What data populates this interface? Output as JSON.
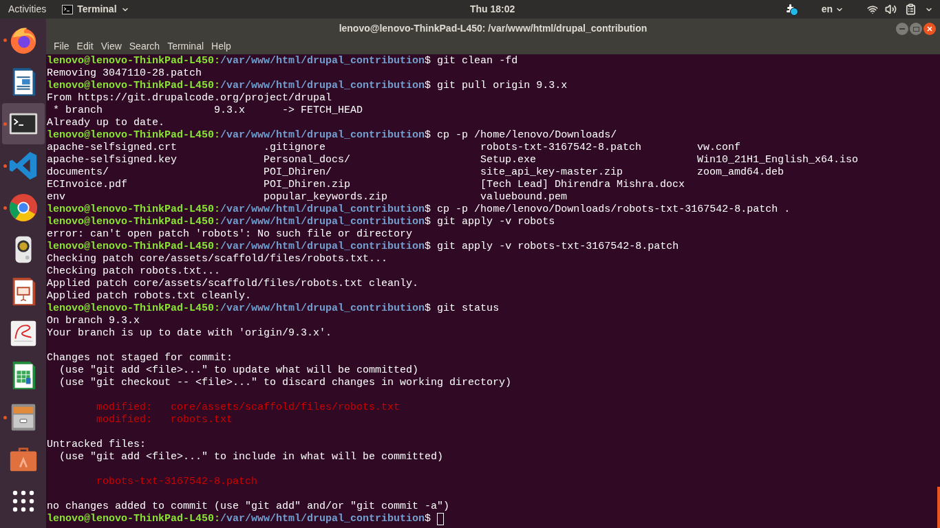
{
  "top_bar": {
    "activities": "Activities",
    "app_menu": "Terminal",
    "clock": "Thu 18:02",
    "language": "en"
  },
  "dock": [
    {
      "kind": "fox",
      "running": true,
      "selected": false
    },
    {
      "kind": "document",
      "running": false,
      "selected": false
    },
    {
      "kind": "terminal",
      "running": true,
      "selected": true
    },
    {
      "kind": "code",
      "running": true,
      "selected": false
    },
    {
      "kind": "globe",
      "running": true,
      "selected": false
    },
    {
      "kind": "speaker",
      "running": false,
      "selected": false
    },
    {
      "kind": "slides",
      "running": false,
      "selected": false
    },
    {
      "kind": "reader",
      "running": false,
      "selected": false
    },
    {
      "kind": "sheet",
      "running": false,
      "selected": false
    },
    {
      "kind": "cabinet",
      "running": true,
      "selected": false
    },
    {
      "kind": "bag",
      "running": false,
      "selected": false
    },
    {
      "kind": "apps",
      "running": false,
      "selected": false
    }
  ],
  "window": {
    "title": "lenovo@lenovo-ThinkPad-L450: /var/www/html/drupal_contribution",
    "menu": [
      "File",
      "Edit",
      "View",
      "Search",
      "Terminal",
      "Help"
    ]
  },
  "terminal": {
    "lines": [
      {
        "kind": "prompt",
        "user": "lenovo@lenovo-ThinkPad-L450:",
        "path": "/var/www/html/drupal_contribution",
        "command": "$ git clean -fd"
      },
      {
        "kind": "output",
        "text": "Removing 3047110-28.patch"
      },
      {
        "kind": "prompt",
        "user": "lenovo@lenovo-ThinkPad-L450:",
        "path": "/var/www/html/drupal_contribution",
        "command": "$ git pull origin 9.3.x"
      },
      {
        "kind": "output",
        "text": "From https://git.drupalcode.org/project/drupal"
      },
      {
        "kind": "output",
        "text": " * branch                  9.3.x      -> FETCH_HEAD"
      },
      {
        "kind": "output",
        "text": "Already up to date."
      },
      {
        "kind": "prompt",
        "user": "lenovo@lenovo-ThinkPad-L450:",
        "path": "/var/www/html/drupal_contribution",
        "command": "$ cp -p /home/lenovo/Downloads/"
      },
      {
        "kind": "columns",
        "cells": [
          "apache-selfsigned.crt",
          ".gitignore",
          "robots-txt-3167542-8.patch",
          "vw.conf"
        ]
      },
      {
        "kind": "columns",
        "cells": [
          "apache-selfsigned.key",
          "Personal_docs/",
          "Setup.exe",
          "Win10_21H1_English_x64.iso"
        ]
      },
      {
        "kind": "columns",
        "cells": [
          "documents/",
          "POI_Dhiren/",
          "site_api_key-master.zip",
          "zoom_amd64.deb"
        ]
      },
      {
        "kind": "columns",
        "cells": [
          "ECInvoice.pdf",
          "POI_Dhiren.zip",
          "[Tech Lead] Dhirendra Mishra.docx"
        ]
      },
      {
        "kind": "columns",
        "cells": [
          "env",
          "popular_keywords.zip",
          "valuebound.pem"
        ]
      },
      {
        "kind": "prompt",
        "user": "lenovo@lenovo-ThinkPad-L450:",
        "path": "/var/www/html/drupal_contribution",
        "command": "$ cp -p /home/lenovo/Downloads/robots-txt-3167542-8.patch ."
      },
      {
        "kind": "prompt",
        "user": "lenovo@lenovo-ThinkPad-L450:",
        "path": "/var/www/html/drupal_contribution",
        "command": "$ git apply -v robots"
      },
      {
        "kind": "output",
        "text": "error: can't open patch 'robots': No such file or directory"
      },
      {
        "kind": "prompt",
        "user": "lenovo@lenovo-ThinkPad-L450:",
        "path": "/var/www/html/drupal_contribution",
        "command": "$ git apply -v robots-txt-3167542-8.patch"
      },
      {
        "kind": "output",
        "text": "Checking patch core/assets/scaffold/files/robots.txt..."
      },
      {
        "kind": "output",
        "text": "Checking patch robots.txt..."
      },
      {
        "kind": "output",
        "text": "Applied patch core/assets/scaffold/files/robots.txt cleanly."
      },
      {
        "kind": "output",
        "text": "Applied patch robots.txt cleanly."
      },
      {
        "kind": "prompt",
        "user": "lenovo@lenovo-ThinkPad-L450:",
        "path": "/var/www/html/drupal_contribution",
        "command": "$ git status"
      },
      {
        "kind": "output",
        "text": "On branch 9.3.x"
      },
      {
        "kind": "output",
        "text": "Your branch is up to date with 'origin/9.3.x'."
      },
      {
        "kind": "blank"
      },
      {
        "kind": "output",
        "text": "Changes not staged for commit:"
      },
      {
        "kind": "output",
        "text": "  (use \"git add <file>...\" to update what will be committed)"
      },
      {
        "kind": "output",
        "text": "  (use \"git checkout -- <file>...\" to discard changes in working directory)"
      },
      {
        "kind": "blank"
      },
      {
        "kind": "changed",
        "text": "modified:   core/assets/scaffold/files/robots.txt"
      },
      {
        "kind": "changed",
        "text": "modified:   robots.txt"
      },
      {
        "kind": "blank"
      },
      {
        "kind": "output",
        "text": "Untracked files:"
      },
      {
        "kind": "output",
        "text": "  (use \"git add <file>...\" to include in what will be committed)"
      },
      {
        "kind": "blank"
      },
      {
        "kind": "changed",
        "text": "robots-txt-3167542-8.patch"
      },
      {
        "kind": "blank"
      },
      {
        "kind": "output",
        "text": "no changes added to commit (use \"git add\" and/or \"git commit -a\")"
      },
      {
        "kind": "prompt",
        "user": "lenovo@lenovo-ThinkPad-L450:",
        "path": "/var/www/html/drupal_contribution",
        "command": "$",
        "cursor": true
      }
    ]
  }
}
